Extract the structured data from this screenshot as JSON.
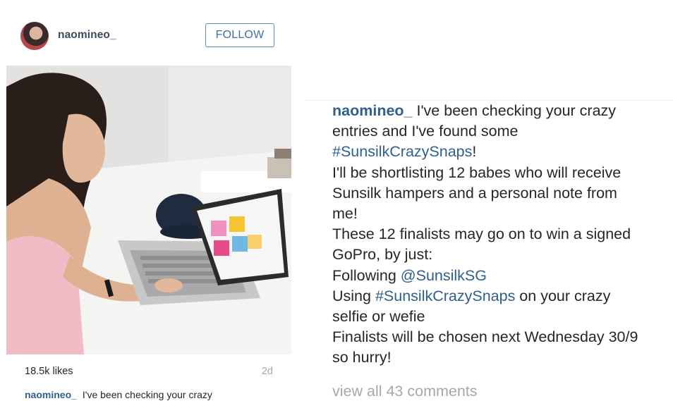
{
  "post": {
    "username": "naomineo_",
    "follow_label": "FOLLOW",
    "likes": "18.5k likes",
    "age": "2d",
    "caption_peek_user": "naomineo_",
    "caption_peek_text": "I've been checking your crazy"
  },
  "caption_panel": {
    "line1_user": "naomineo_",
    "line1_text": " I've been checking your crazy",
    "line2": "entries and I've found some",
    "line3_tag": "#SunsilkCrazySnaps",
    "line3_text": "!",
    "line4": "I'll be shortlisting 12 babes who will receive",
    "line5": "Sunsilk hampers and a personal note from",
    "line6": "me!",
    "line7": "These 12 finalists may go on to win a signed",
    "line8": "GoPro, by just:",
    "line9_text": "Following ",
    "line9_mention": "@SunsilkSG",
    "line10_text": "Using ",
    "line10_tag": "#SunsilkCrazySnaps",
    "line10_rest": " on your crazy",
    "line11": "selfie or wefie",
    "line12": "Finalists will be chosen next Wednesday 30/9",
    "line13": "so hurry!",
    "view_all": "view all 43 comments"
  },
  "colors": {
    "link_blue": "#2f5f8f",
    "follow_border": "#5a8ab8",
    "muted_gray": "#a8a8a8",
    "text": "#262626"
  },
  "icons": {
    "avatar": "profile-photo"
  }
}
